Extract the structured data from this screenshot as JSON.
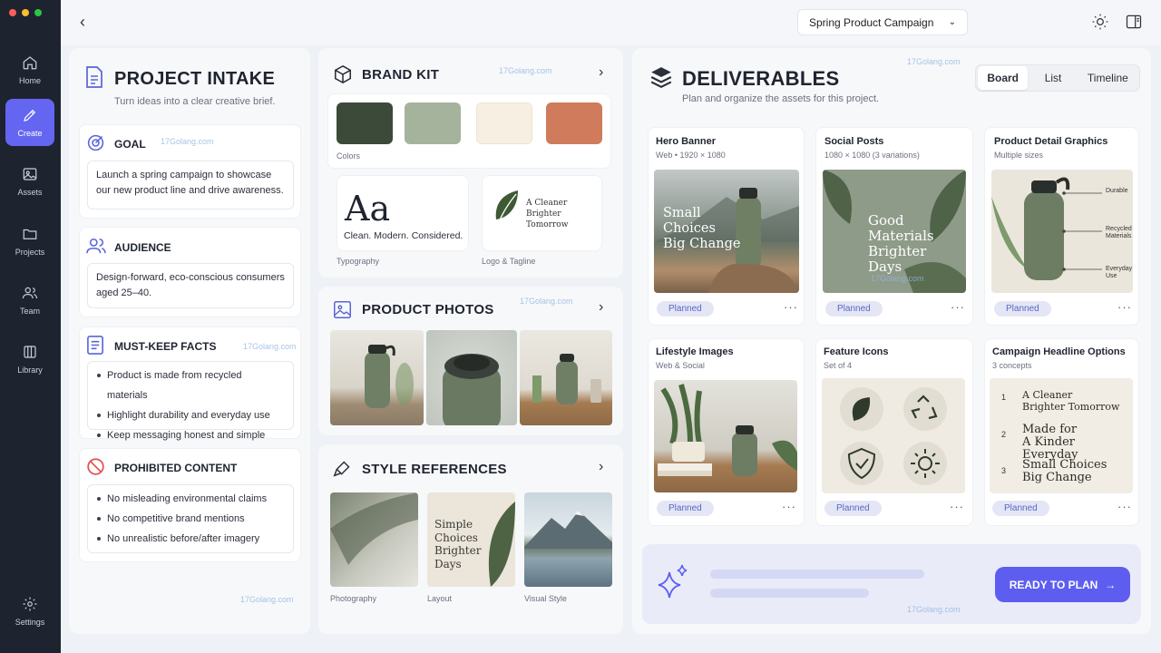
{
  "rail": {
    "items": [
      {
        "label": "Home",
        "icon": "home-icon"
      },
      {
        "label": "Create",
        "icon": "pencil-icon"
      },
      {
        "label": "Assets",
        "icon": "image-icon"
      },
      {
        "label": "Projects",
        "icon": "folder-icon"
      },
      {
        "label": "Team",
        "icon": "users-icon"
      },
      {
        "label": "Library",
        "icon": "library-icon"
      }
    ],
    "settings": "Settings"
  },
  "topbar": {
    "campaign": "Spring Product Campaign"
  },
  "intake": {
    "title": "PROJECT INTAKE",
    "subtitle": "Turn ideas into a clear creative brief.",
    "goal_title": "GOAL",
    "goal_text": "Launch a spring campaign to showcase our new product line and drive awareness.",
    "audience_title": "AUDIENCE",
    "audience_text": "Design-forward, eco-conscious consumers aged 25–40.",
    "facts_title": "MUST-KEEP FACTS",
    "facts": [
      "Product is made from recycled materials",
      "Highlight durability and everyday use",
      "Keep messaging honest and simple"
    ],
    "prohibited_title": "PROHIBITED CONTENT",
    "prohibited": [
      "No misleading environmental claims",
      "No competitive brand mentions",
      "No unrealistic before/after imagery"
    ]
  },
  "brand": {
    "title": "BRAND KIT",
    "colors_label": "Colors",
    "colors": [
      "#3c4a3a",
      "#a6b39c",
      "#f6efe2",
      "#cf7b5c"
    ],
    "type_sample": "Aa",
    "type_tagline": "Clean. Modern. Considered.",
    "typography_label": "Typography",
    "logo_line1": "A Cleaner",
    "logo_line2": "Brighter Tomorrow",
    "logo_label": "Logo & Tagline"
  },
  "photos": {
    "title": "PRODUCT PHOTOS"
  },
  "style": {
    "title": "STYLE REFERENCES",
    "layout_text": [
      "Simple",
      "Choices",
      "Brighter",
      "Days"
    ],
    "labels": [
      "Photography",
      "Layout",
      "Visual Style"
    ]
  },
  "deliverables": {
    "title": "DELIVERABLES",
    "subtitle": "Plan and organize the assets for this project.",
    "tabs": [
      "Board",
      "List",
      "Timeline"
    ],
    "status": "Planned",
    "items": [
      {
        "title": "Hero Banner",
        "sub": "Web • 1920 × 1080",
        "overlay": [
          "Small",
          "Choices",
          "Big Change"
        ]
      },
      {
        "title": "Social Posts",
        "sub": "1080 × 1080 (3 variations)",
        "overlay": [
          "Good",
          "Materials",
          "Brighter",
          "Days"
        ]
      },
      {
        "title": "Product Detail Graphics",
        "sub": "Multiple sizes",
        "callouts": [
          "Durable",
          "Recycled Materials",
          "Everyday Use"
        ]
      },
      {
        "title": "Lifestyle Images",
        "sub": "Web & Social"
      },
      {
        "title": "Feature Icons",
        "sub": "Set of 4"
      },
      {
        "title": "Campaign Headline Options",
        "sub": "3 concepts",
        "headlines": [
          {
            "n": "1",
            "l1": "A Cleaner",
            "l2": "Brighter Tomorrow"
          },
          {
            "n": "2",
            "l1": "Made for",
            "l2": "A Kinder Everyday"
          },
          {
            "n": "3",
            "l1": "Small Choices",
            "l2": "Big Change"
          }
        ]
      }
    ],
    "ready": "READY TO PLAN"
  },
  "watermark": "17Golang.com"
}
